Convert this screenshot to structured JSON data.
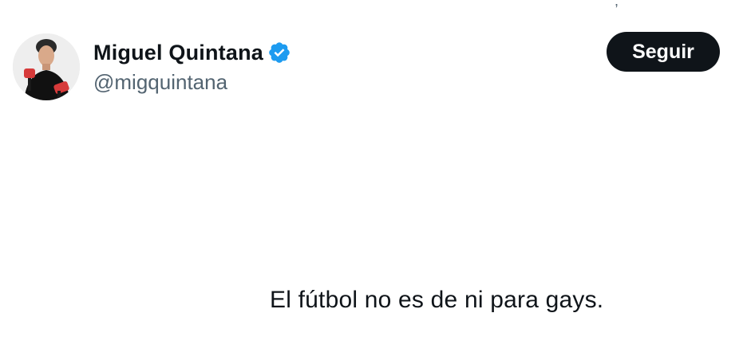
{
  "tweet": {
    "author": {
      "display_name": "Miguel Quintana",
      "handle": "@migquintana",
      "verified": true,
      "avatar_icon": "profile-photo"
    },
    "follow_label": "Seguir",
    "text": "El fútbol no es de ni para gays."
  },
  "colors": {
    "text_primary": "#0f1419",
    "text_secondary": "#536471",
    "verified_blue": "#1d9bf0",
    "button_bg": "#0f1419",
    "button_text": "#ffffff"
  }
}
